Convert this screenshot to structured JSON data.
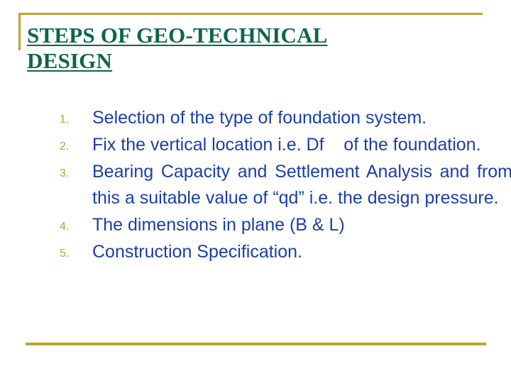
{
  "slide": {
    "title_lines": [
      "STEPS OF GEO-TECHNICAL",
      "DESIGN"
    ],
    "colors": {
      "title_green": "#0d6648",
      "body_blue": "#1b3fa8",
      "accent_gold": "#bfa22e",
      "background": "#ffffff"
    },
    "list": {
      "items": [
        {
          "marker": "1.",
          "text": "Selection of the type of foundation system."
        },
        {
          "marker": "2.",
          "text": "Fix the vertical location i.e. Df    of the foundation."
        },
        {
          "marker": "3.",
          "text": "Bearing Capacity and Settlement Analysis and from this a suitable value of “qd” i.e. the design pressure."
        },
        {
          "marker": "4.",
          "text": "The dimensions in plane (B & L)"
        },
        {
          "marker": "5.",
          "text": "Construction Specification."
        }
      ]
    }
  }
}
